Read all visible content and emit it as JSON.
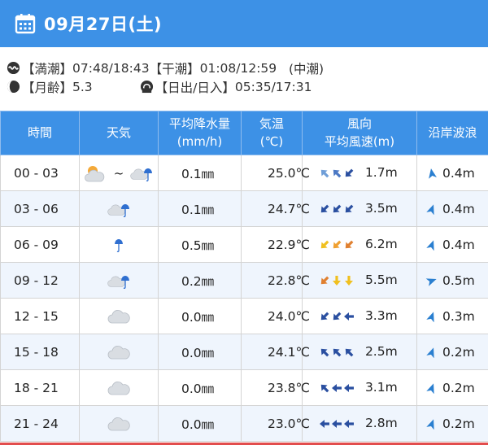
{
  "header": {
    "date": "09月27日(土)",
    "icon": "calendar-icon"
  },
  "info": {
    "tide_high_label": "【満潮】",
    "tide_high": "07:48/18:43",
    "tide_low_label": "【干潮】",
    "tide_low": "01:08/12:59",
    "tide_type": "(中潮)",
    "moon_label": "【月齢】",
    "moon_age": "5.3",
    "sun_label": "【日出/日入】",
    "sun_times": "05:35/17:31"
  },
  "table": {
    "headers": {
      "time": "時間",
      "weather": "天気",
      "rain_1": "平均降水量",
      "rain_2": "(mm/h)",
      "temp_1": "気温",
      "temp_2": "(℃)",
      "wind_1": "風向",
      "wind_2": "平均風速(m)",
      "wave": "沿岸波浪"
    },
    "rows": [
      {
        "time": "00 - 03",
        "weather": "cloudy-sun-then-rain",
        "tilde": "~",
        "rain": "0.1㎜",
        "temp": "25.0℃",
        "wind_dirs": [
          "NW",
          "NW",
          "SW"
        ],
        "wind_colors": [
          "#6f9ed8",
          "#4b78c4",
          "#2a4fa0"
        ],
        "wind": "1.7m",
        "wave_dir": "N",
        "wave": "0.4m"
      },
      {
        "time": "03 - 06",
        "weather": "cloud-rain",
        "rain": "0.1㎜",
        "temp": "24.7℃",
        "wind_dirs": [
          "SW",
          "SW",
          "SW"
        ],
        "wind_colors": [
          "#2a4fa0",
          "#2a4fa0",
          "#2a4fa0"
        ],
        "wind": "3.5m",
        "wave_dir": "NE",
        "wave": "0.4m"
      },
      {
        "time": "06 - 09",
        "weather": "rain",
        "rain": "0.5㎜",
        "temp": "22.9℃",
        "wind_dirs": [
          "SW",
          "SW",
          "SW"
        ],
        "wind_colors": [
          "#f0c020",
          "#f0a030",
          "#e08030"
        ],
        "wind": "6.2m",
        "wave_dir": "NE",
        "wave": "0.4m"
      },
      {
        "time": "09 - 12",
        "weather": "cloud-rain",
        "rain": "0.2㎜",
        "temp": "22.8℃",
        "wind_dirs": [
          "SW",
          "S",
          "S"
        ],
        "wind_colors": [
          "#e08030",
          "#f0c020",
          "#f0c020"
        ],
        "wind": "5.5m",
        "wave_dir": "E",
        "wave": "0.5m"
      },
      {
        "time": "12 - 15",
        "weather": "cloud",
        "rain": "0.0㎜",
        "temp": "24.0℃",
        "wind_dirs": [
          "SW",
          "SW",
          "W"
        ],
        "wind_colors": [
          "#2a4fa0",
          "#2a4fa0",
          "#2a4fa0"
        ],
        "wind": "3.3m",
        "wave_dir": "NE",
        "wave": "0.3m"
      },
      {
        "time": "15 - 18",
        "weather": "cloud",
        "rain": "0.0㎜",
        "temp": "24.1℃",
        "wind_dirs": [
          "NW",
          "NW",
          "NW"
        ],
        "wind_colors": [
          "#2a4fa0",
          "#2a4fa0",
          "#2a4fa0"
        ],
        "wind": "2.5m",
        "wave_dir": "NE",
        "wave": "0.2m"
      },
      {
        "time": "18 - 21",
        "weather": "cloud",
        "rain": "0.0㎜",
        "temp": "23.8℃",
        "wind_dirs": [
          "NW",
          "W",
          "W"
        ],
        "wind_colors": [
          "#2a4fa0",
          "#2a4fa0",
          "#2a4fa0"
        ],
        "wind": "3.1m",
        "wave_dir": "NE",
        "wave": "0.2m"
      },
      {
        "time": "21 - 24",
        "weather": "cloud",
        "rain": "0.0㎜",
        "temp": "23.0℃",
        "wind_dirs": [
          "W",
          "W",
          "W"
        ],
        "wind_colors": [
          "#2a4fa0",
          "#2a4fa0",
          "#2a4fa0"
        ],
        "wind": "2.8m",
        "wave_dir": "NE",
        "wave": "0.2m"
      }
    ]
  },
  "colors": {
    "header_bg": "#3d91e6",
    "alt_row": "#eff5fd",
    "bottom_line": "#e24d4d"
  }
}
